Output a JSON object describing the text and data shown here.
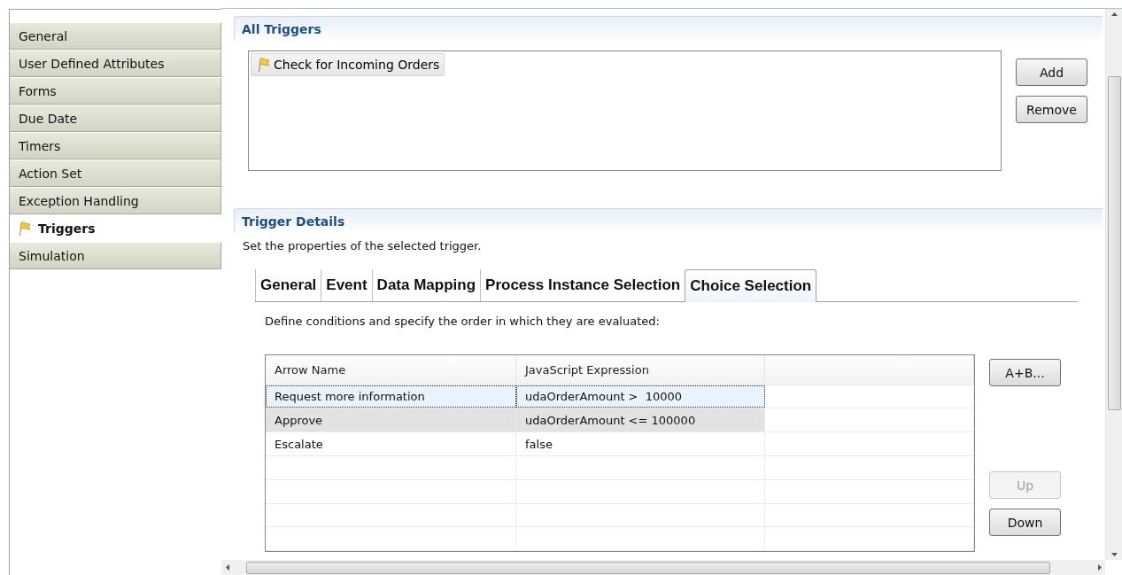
{
  "sidebar": {
    "items": [
      {
        "label": "General",
        "selected": false
      },
      {
        "label": "User Defined Attributes",
        "selected": false
      },
      {
        "label": "Forms",
        "selected": false
      },
      {
        "label": "Due Date",
        "selected": false
      },
      {
        "label": "Timers",
        "selected": false
      },
      {
        "label": "Action Set",
        "selected": false
      },
      {
        "label": "Exception Handling",
        "selected": false
      },
      {
        "label": "Triggers",
        "selected": true
      },
      {
        "label": "Simulation",
        "selected": false
      }
    ]
  },
  "all_triggers": {
    "title": "All Triggers",
    "items": [
      {
        "label": "Check for Incoming Orders",
        "selected": true
      }
    ],
    "buttons": [
      {
        "label": "Add",
        "disabled": false
      },
      {
        "label": "Remove",
        "disabled": false
      }
    ]
  },
  "trigger_details": {
    "title": "Trigger Details",
    "description": "Set the properties of the selected trigger.",
    "tabs": [
      {
        "label": "General",
        "selected": false
      },
      {
        "label": "Event",
        "selected": false
      },
      {
        "label": "Data Mapping",
        "selected": false
      },
      {
        "label": "Process Instance Selection",
        "selected": false
      },
      {
        "label": "Choice Selection",
        "selected": true
      }
    ],
    "instructions": "Define conditions and specify the order in which they are evaluated:",
    "table": {
      "columns": [
        "Arrow Name",
        "JavaScript Expression"
      ],
      "rows": [
        {
          "cells": [
            "Request more information",
            "udaOrderAmount >  10000"
          ],
          "selected": true,
          "hovered": false
        },
        {
          "cells": [
            "Approve",
            "udaOrderAmount <= 100000"
          ],
          "selected": false,
          "hovered": true
        },
        {
          "cells": [
            "Escalate",
            "false"
          ],
          "selected": false,
          "hovered": false
        }
      ]
    },
    "buttons": [
      {
        "label": "A+B...",
        "disabled": false
      },
      {
        "label": "Up",
        "disabled": true
      },
      {
        "label": "Down",
        "disabled": false
      }
    ]
  }
}
